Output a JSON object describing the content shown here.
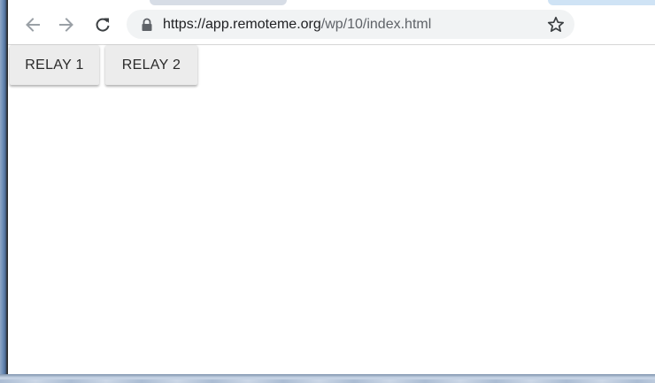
{
  "browser": {
    "toolbar": {
      "back_icon": "arrow-left-icon",
      "forward_icon": "arrow-right-icon",
      "reload_icon": "reload-icon",
      "bookmark_icon": "star-icon"
    },
    "address_bar": {
      "url_host": "https://app.remoteme.org",
      "url_path": "/wp/10/index.html",
      "secure_icon": "lock-icon"
    }
  },
  "page": {
    "buttons": [
      {
        "label": "RELAY 1"
      },
      {
        "label": "RELAY 2"
      }
    ]
  },
  "colors": {
    "button_bg": "#ececec",
    "omnibox_bg": "#f1f3f4",
    "icon_color": "#5f6368"
  }
}
